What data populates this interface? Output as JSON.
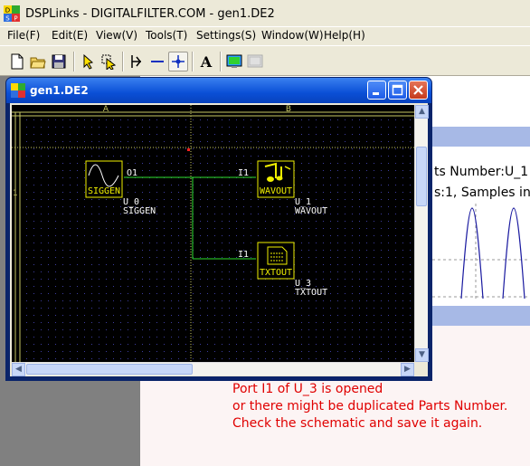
{
  "app": {
    "title": "DSPLinks - DIGITALFILTER.COM - gen1.DE2",
    "icon": "dsp-app-icon"
  },
  "menu": {
    "items": [
      {
        "label": "File(F)"
      },
      {
        "label": "Edit(E)"
      },
      {
        "label": "View(V)"
      },
      {
        "label": "Tools(T)"
      },
      {
        "label": "Settings(S)"
      },
      {
        "label": "Window(W)"
      },
      {
        "label": "Help(H)"
      }
    ]
  },
  "toolbar": {
    "icons": [
      "new-file-icon",
      "open-folder-icon",
      "save-disk-icon",
      "select-arrow-icon",
      "move-arrow-icon",
      "connect-wire-icon",
      "horizontal-line-icon",
      "junction-dot-icon",
      "text-tool-icon",
      "monitor-icon",
      "disabled-screen-icon"
    ],
    "text_label": "A"
  },
  "schematic_window": {
    "title": "gen1.DE2",
    "grid": {
      "columns": [
        "A",
        "B"
      ],
      "rows": [
        "1"
      ],
      "dot_color": "#3c3ca0",
      "divider_color": "#c8c864"
    },
    "blocks": [
      {
        "name": "SIGGEN",
        "id": "U_0",
        "type": "SIGGEN",
        "port": "O1",
        "icon": "sine-wave-icon"
      },
      {
        "name": "WAVOUT",
        "id": "U_1",
        "type": "WAVOUT",
        "port": "I1",
        "icon": "music-notes-icon"
      },
      {
        "name": "TXTOUT",
        "id": "U_3",
        "type": "TXTOUT",
        "port": "I1",
        "icon": "text-file-icon"
      }
    ],
    "colors": {
      "wire": "#2ee02e",
      "block_border": "#f0f000",
      "label": "#ffffff"
    }
  },
  "background_window": {
    "parts_line": "ts Number:U_1",
    "samples_line": "s:1, Samples in",
    "chart_color": "#1a1aa0",
    "title_color": "#a7b9e6"
  },
  "error_log": {
    "lines": [
      "Port I1 of U_3 is opened",
      "or there might be duplicated Parts Number.",
      "Check the schematic and save it again."
    ],
    "color": "#e00000"
  }
}
